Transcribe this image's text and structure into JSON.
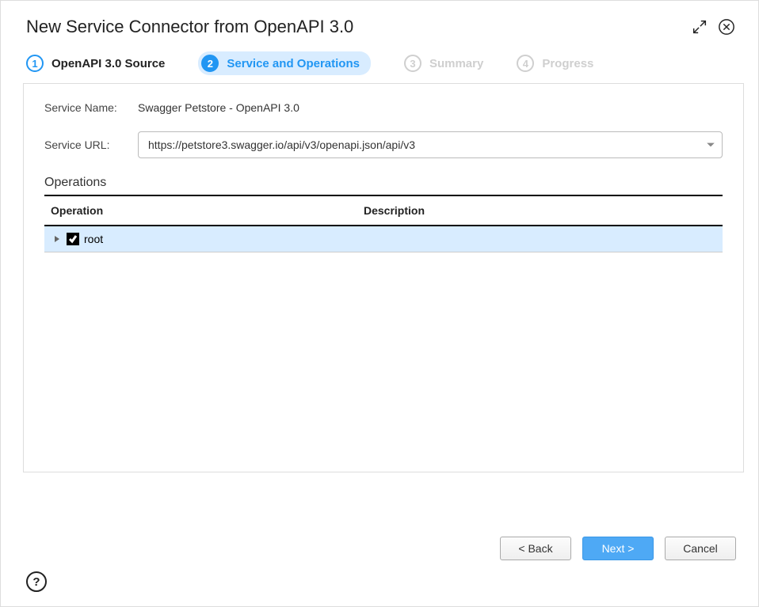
{
  "dialog": {
    "title": "New Service Connector from OpenAPI 3.0"
  },
  "steps": [
    {
      "num": "1",
      "label": "OpenAPI 3.0 Source",
      "state": "done"
    },
    {
      "num": "2",
      "label": "Service and Operations",
      "state": "active"
    },
    {
      "num": "3",
      "label": "Summary",
      "state": "future"
    },
    {
      "num": "4",
      "label": "Progress",
      "state": "future"
    }
  ],
  "form": {
    "service_name_label": "Service Name:",
    "service_name_value": "Swagger Petstore - OpenAPI 3.0",
    "service_url_label": "Service URL:",
    "service_url_value": "https://petstore3.swagger.io/api/v3/openapi.json/api/v3"
  },
  "operations": {
    "section_label": "Operations",
    "col_operation": "Operation",
    "col_description": "Description",
    "rows": [
      {
        "label": "root",
        "checked": true,
        "expandable": true
      }
    ]
  },
  "buttons": {
    "back": "< Back",
    "next": "Next >",
    "cancel": "Cancel"
  },
  "help": "?"
}
